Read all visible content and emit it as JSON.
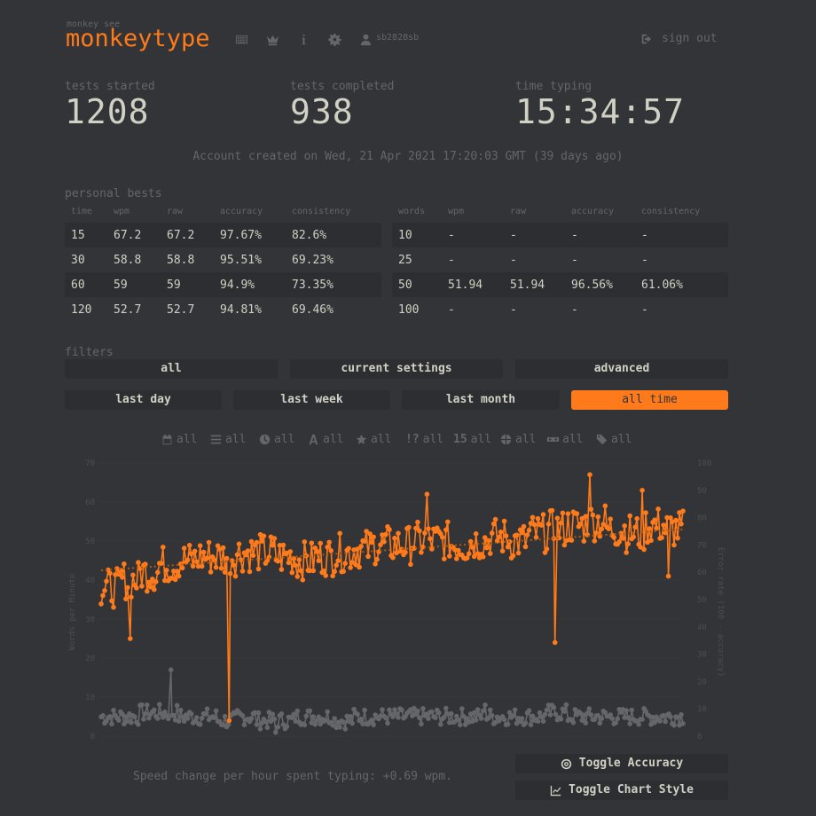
{
  "header": {
    "logo_small": "monkey see",
    "logo": "monkeytype",
    "username": "sb2828sb",
    "signout": "sign out",
    "icons": [
      "keyboard-icon",
      "crown-icon",
      "info-icon",
      "gear-icon",
      "user-icon"
    ]
  },
  "stats": [
    {
      "label": "tests started",
      "value": "1208"
    },
    {
      "label": "tests completed",
      "value": "938"
    },
    {
      "label": "time typing",
      "value": "15:34:57"
    }
  ],
  "account_created": "Account created on Wed, 21 Apr 2021 17:20:03 GMT (39 days ago)",
  "personal_bests": {
    "title": "personal bests",
    "time": {
      "headers": [
        "time",
        "wpm",
        "raw",
        "accuracy",
        "consistency"
      ],
      "rows": [
        [
          "15",
          "67.2",
          "67.2",
          "97.67%",
          "82.6%"
        ],
        [
          "30",
          "58.8",
          "58.8",
          "95.51%",
          "69.23%"
        ],
        [
          "60",
          "59",
          "59",
          "94.9%",
          "73.35%"
        ],
        [
          "120",
          "52.7",
          "52.7",
          "94.81%",
          "69.46%"
        ]
      ]
    },
    "words": {
      "headers": [
        "words",
        "wpm",
        "raw",
        "accuracy",
        "consistency"
      ],
      "rows": [
        [
          "10",
          "-",
          "-",
          "-",
          "-"
        ],
        [
          "25",
          "-",
          "-",
          "-",
          "-"
        ],
        [
          "50",
          "51.94",
          "51.94",
          "96.56%",
          "61.06%"
        ],
        [
          "100",
          "-",
          "-",
          "-",
          "-"
        ]
      ]
    }
  },
  "filters": {
    "title": "filters",
    "presets": [
      "all",
      "current settings",
      "advanced"
    ],
    "timespan": [
      "last day",
      "last week",
      "last month",
      "all time"
    ],
    "active_timespan": "all time",
    "chips": [
      {
        "icon": "calendar-icon",
        "label": "all"
      },
      {
        "icon": "list-icon",
        "label": "all"
      },
      {
        "icon": "clock-icon",
        "label": "all"
      },
      {
        "icon": "font-icon",
        "label": "all"
      },
      {
        "icon": "star-icon",
        "label": "all"
      },
      {
        "icon": "punctuation-icon",
        "label": "all"
      },
      {
        "icon": "numbers-icon",
        "label": "all"
      },
      {
        "icon": "globe-icon",
        "label": "all"
      },
      {
        "icon": "funbox-icon",
        "label": "all"
      },
      {
        "icon": "tags-icon",
        "label": "all"
      }
    ]
  },
  "colors": {
    "accent": "#ff7a1a",
    "error_series": "#646669",
    "background": "#323437"
  },
  "chart_data": {
    "type": "line",
    "ylabel": "Words per Minute",
    "y2label": "Error rate (100 - accuracy)",
    "ylim": [
      0,
      70
    ],
    "y2lim": [
      0,
      100
    ],
    "yticks": [
      0,
      10,
      20,
      30,
      40,
      50,
      60,
      70
    ],
    "y2ticks": [
      0,
      10,
      20,
      30,
      40,
      50,
      60,
      70,
      80,
      90,
      100
    ],
    "series": [
      {
        "color": "#ff7a1a",
        "trend_start": 42.5,
        "trend_end": 53,
        "segments_mean": [
          38,
          40,
          42,
          44,
          45,
          46,
          46,
          47,
          47,
          46,
          45,
          46,
          47,
          48,
          49,
          49,
          50,
          50,
          49,
          50,
          51,
          50,
          52,
          53,
          54,
          55,
          53,
          52,
          54,
          53
        ],
        "outliers": [
          [
            0.05,
            25
          ],
          [
            0.22,
            4
          ],
          [
            0.56,
            62
          ],
          [
            0.78,
            24
          ],
          [
            0.84,
            67
          ],
          [
            0.93,
            63
          ],
          [
            0.975,
            41
          ]
        ]
      },
      {
        "color": "#646669",
        "segments_mean": [
          5,
          5,
          6,
          6,
          5,
          5,
          4,
          5,
          4,
          4,
          5,
          5,
          4,
          5,
          5,
          5,
          5,
          5,
          5,
          5,
          5,
          5,
          5,
          6,
          5,
          5,
          5,
          5,
          5,
          5
        ],
        "outliers": [
          [
            0.12,
            17
          ],
          [
            0.3,
            1
          ],
          [
            0.66,
            8
          ]
        ]
      }
    ],
    "points": 938
  },
  "speed_change": "Speed change per hour spent typing: +0.69 wpm.",
  "actions": {
    "toggle_accuracy": "Toggle Accuracy",
    "toggle_style": "Toggle Chart Style"
  }
}
